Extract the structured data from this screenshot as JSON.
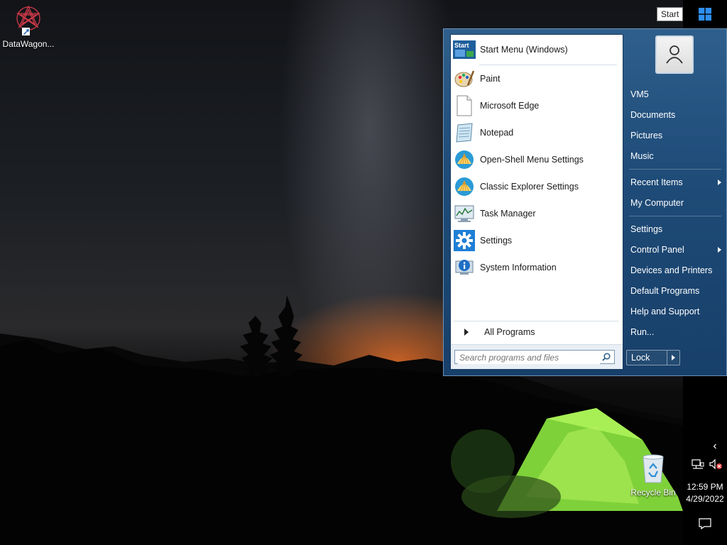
{
  "desktop": {
    "icons": [
      {
        "label": "DataWagon...",
        "icon": "datawagon-shortcut-icon"
      },
      {
        "label": "Recycle Bin",
        "icon": "recycle-bin-icon"
      }
    ]
  },
  "taskbar": {
    "start_tooltip": "Start",
    "clock_time": "12:59 PM",
    "clock_date": "4/29/2022"
  },
  "start_menu": {
    "left_items": [
      {
        "label": "Start Menu (Windows)",
        "icon": "start-menu-icon"
      },
      {
        "label": "Paint",
        "icon": "paint-icon"
      },
      {
        "label": "Microsoft Edge",
        "icon": "blank-document-icon"
      },
      {
        "label": "Notepad",
        "icon": "notepad-icon"
      },
      {
        "label": "Open-Shell Menu Settings",
        "icon": "shell-icon"
      },
      {
        "label": "Classic Explorer Settings",
        "icon": "shell-icon"
      },
      {
        "label": "Task Manager",
        "icon": "task-manager-icon"
      },
      {
        "label": "Settings",
        "icon": "gear-icon"
      },
      {
        "label": "System Information",
        "icon": "info-icon"
      }
    ],
    "all_programs": "All Programs",
    "search_placeholder": "Search programs and files",
    "right_items": [
      {
        "label": "VM5"
      },
      {
        "label": "Documents"
      },
      {
        "label": "Pictures"
      },
      {
        "label": "Music"
      },
      {
        "label": "Recent Items",
        "submenu": true
      },
      {
        "label": "My Computer"
      },
      {
        "label": "Settings"
      },
      {
        "label": "Control Panel",
        "submenu": true
      },
      {
        "label": "Devices and Printers"
      },
      {
        "label": "Default Programs"
      },
      {
        "label": "Help and Support"
      },
      {
        "label": "Run..."
      }
    ],
    "lock_label": "Lock"
  },
  "colors": {
    "menu_blue": "#1f4c79",
    "taskbar": "#000000",
    "tent_green": "#8fe53a"
  }
}
